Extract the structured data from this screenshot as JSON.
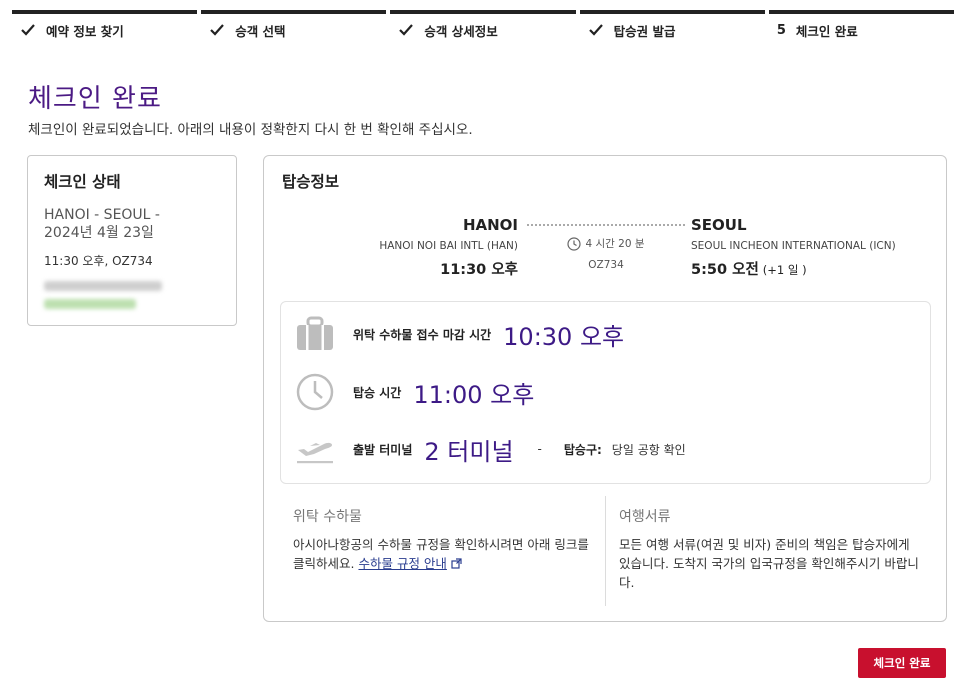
{
  "steps": [
    {
      "label": "예약 정보 찾기",
      "done": true
    },
    {
      "label": "승객 선택",
      "done": true
    },
    {
      "label": "승객 상세정보",
      "done": true
    },
    {
      "label": "탑승권 발급",
      "done": true
    },
    {
      "label": "체크인 완료",
      "number": "5",
      "done": false
    }
  ],
  "header": {
    "title": "체크인 완료",
    "subtitle": "체크인이 완료되었습니다. 아래의 내용이 정확한지 다시 한 번 확인해 주십시오."
  },
  "status_card": {
    "title": "체크인 상태",
    "route_line1": "HANOI - SEOUL -",
    "route_line2": "2024년 4월 23일",
    "flight_line": "11:30 오후, OZ734"
  },
  "boarding": {
    "title": "탑승정보",
    "departure": {
      "city": "HANOI",
      "airport": "HANOI NOI BAI INTL (HAN)",
      "time": "11:30 오후"
    },
    "arrival": {
      "city": "SEOUL",
      "airport": "SEOUL INCHEON INTERNATIONAL (ICN)",
      "time": "5:50 오전",
      "day_offset": "(+1 일 )"
    },
    "duration": "4 시간 20 분",
    "flight_no": "OZ734",
    "baggage_deadline_label": "위탁 수하물 접수 마감 시간",
    "baggage_deadline_value": "10:30 오후",
    "boarding_time_label": "탑승 시간",
    "boarding_time_value": "11:00 오후",
    "terminal_label": "출발 터미널",
    "terminal_value": "2 터미널",
    "separator": "-",
    "gate_label": "탑승구:",
    "gate_value": "당일 공항 확인"
  },
  "notes": {
    "baggage_title": "위탁 수하물",
    "baggage_text": "아시아나항공의 수하물 규정을 확인하시려면 아래 링크를 클릭하세요.",
    "baggage_link": "수하물 규정 안내",
    "docs_title": "여행서류",
    "docs_text": "모든 여행 서류(여권 및 비자) 준비의 책임은 탑승자에게 있습니다. 도착지 국가의 입국규정을 확인해주시기 바랍니다."
  },
  "footer": {
    "done_label": "체크인 완료"
  },
  "colors": {
    "accent": "#4b1a84",
    "value": "#3d1a86",
    "button": "#c8102e"
  }
}
